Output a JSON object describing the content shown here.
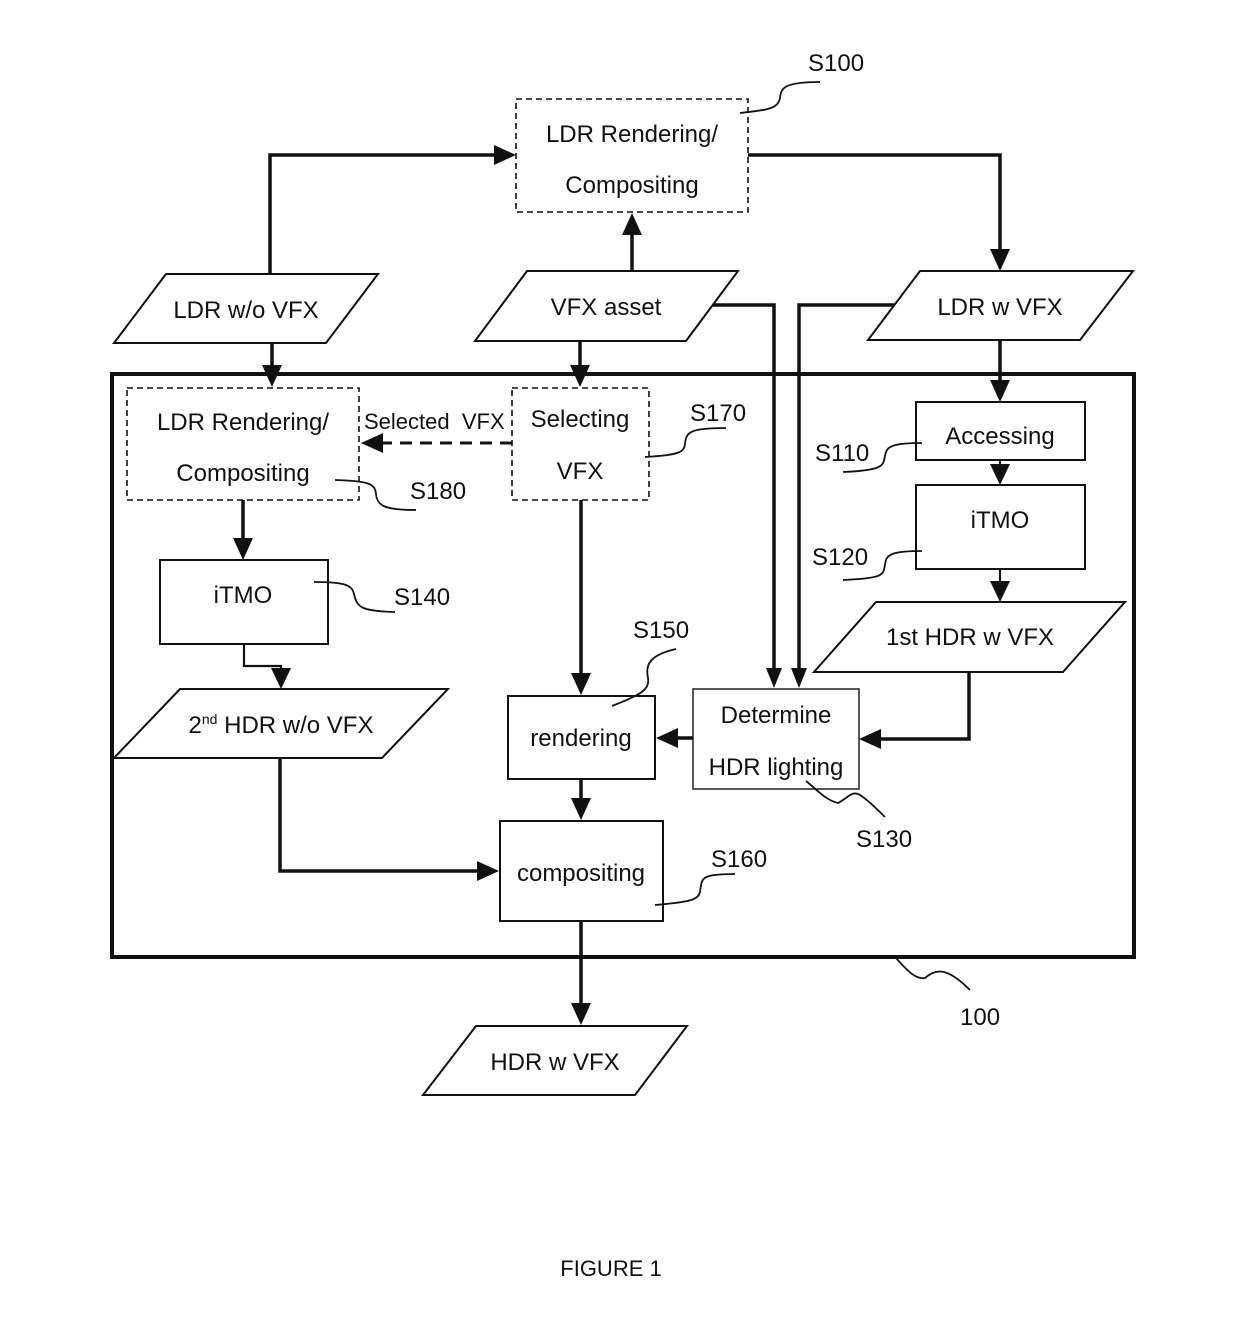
{
  "figure": {
    "caption": "FIGURE 1",
    "system_ref": "100"
  },
  "nodes": {
    "s100": {
      "line1": "LDR Rendering/",
      "line2": "Compositing",
      "ref": "S100",
      "style": "dashed-process"
    },
    "ldr_wo_vfx": {
      "label": "LDR w/o VFX",
      "style": "data"
    },
    "vfx_asset": {
      "label": "VFX asset",
      "style": "data"
    },
    "ldr_w_vfx": {
      "label": "LDR w VFX",
      "style": "data"
    },
    "s180": {
      "line1": "LDR Rendering/",
      "line2": "Compositing",
      "ref": "S180",
      "style": "dashed-process"
    },
    "s170": {
      "line1": "Selecting",
      "line2": "VFX",
      "ref": "S170",
      "style": "dashed-process"
    },
    "selected_vfx": {
      "label": "Selected  VFX"
    },
    "s110": {
      "label": "Accessing",
      "ref": "S110",
      "style": "process"
    },
    "s120": {
      "label": "iTMO",
      "ref": "S120",
      "style": "process"
    },
    "first_hdr": {
      "label": "1st HDR w VFX",
      "style": "data"
    },
    "s140": {
      "label": "iTMO",
      "ref": "S140",
      "style": "process"
    },
    "second_hdr": {
      "prefix": "2",
      "sup": "nd",
      "label": " HDR w/o VFX",
      "style": "data"
    },
    "s150": {
      "label": "rendering",
      "ref": "S150",
      "style": "process"
    },
    "s130": {
      "line1": "Determine",
      "line2": "HDR lighting",
      "ref": "S130",
      "style": "process"
    },
    "s160": {
      "label": "compositing",
      "ref": "S160",
      "style": "process"
    },
    "hdr_w_vfx": {
      "label": "HDR w VFX",
      "style": "data"
    }
  },
  "edges": [
    {
      "from": "ldr_wo_vfx",
      "to": "s100"
    },
    {
      "from": "vfx_asset",
      "to": "s100"
    },
    {
      "from": "s100",
      "to": "ldr_w_vfx"
    },
    {
      "from": "ldr_wo_vfx",
      "to": "s180"
    },
    {
      "from": "vfx_asset",
      "to": "s170"
    },
    {
      "from": "s170",
      "to": "s180",
      "label": "Selected  VFX",
      "style": "dashed"
    },
    {
      "from": "vfx_asset",
      "to": "s130"
    },
    {
      "from": "ldr_w_vfx",
      "to": "s130"
    },
    {
      "from": "ldr_w_vfx",
      "to": "s110"
    },
    {
      "from": "s110",
      "to": "s120"
    },
    {
      "from": "s120",
      "to": "first_hdr"
    },
    {
      "from": "first_hdr",
      "to": "s130"
    },
    {
      "from": "s180",
      "to": "s140"
    },
    {
      "from": "s140",
      "to": "second_hdr"
    },
    {
      "from": "s170",
      "to": "s150"
    },
    {
      "from": "s130",
      "to": "s150"
    },
    {
      "from": "s150",
      "to": "s160"
    },
    {
      "from": "second_hdr",
      "to": "s160"
    },
    {
      "from": "s160",
      "to": "hdr_w_vfx"
    }
  ]
}
